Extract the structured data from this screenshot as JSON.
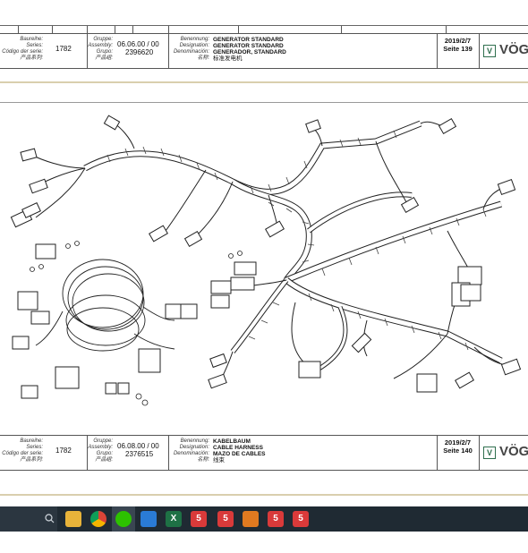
{
  "top_strip": {},
  "header1": {
    "series_label_de": "Baureihe:",
    "series_label_en": "Series:",
    "series_label_es": "Código der serie:",
    "series_label_cn": "产品系列:",
    "series_value": "1782",
    "group_label_de": "Gruppe:",
    "group_label_en": "Assembly:",
    "group_label_es": "Grupo:",
    "group_label_cn": "产品组:",
    "group_value": "06.06.00 / 00",
    "group_number": "2396620",
    "name_label_de": "Benennung:",
    "name_label_en": "Designation:",
    "name_label_es": "Denominación:",
    "name_label_cn": "名称:",
    "name_de": "GENERATOR STANDARD",
    "name_en": "GENERATOR STANDARD",
    "name_es": "GENERADOR, STANDARD",
    "name_cn": "标准发电机",
    "date": "2019/2/7",
    "page": "Seite 139",
    "logo_text": "VÖG"
  },
  "header2": {
    "series_label_de": "Baureihe:",
    "series_label_en": "Series:",
    "series_label_es": "Código der serie:",
    "series_label_cn": "产品系列:",
    "series_value": "1782",
    "group_label_de": "Gruppe:",
    "group_label_en": "Assembly:",
    "group_label_es": "Grupo:",
    "group_label_cn": "产品组:",
    "group_value": "06.08.00 / 00",
    "group_number": "2376515",
    "name_label_de": "Benennung:",
    "name_label_en": "Designation:",
    "name_label_es": "Denominación:",
    "name_label_cn": "名称:",
    "name_de": "KABELBAUM",
    "name_en": "CABLE HARNESS",
    "name_es": "MAZO DE CABLES",
    "name_cn": "线束",
    "date": "2019/2/7",
    "page": "Seite 140",
    "logo_text": "VÖG"
  },
  "drawing": {
    "subject": "cable-harness-exploded-drawing"
  },
  "taskbar": {
    "search_icon": "search-icon",
    "apps": [
      "file-explorer-icon",
      "chrome-icon",
      "wechat-icon",
      "app-icon",
      "excel-icon",
      "app-f5-icon",
      "app-f5-icon",
      "app-orange-icon",
      "app-f5-icon",
      "app-f5-icon"
    ],
    "colors": {
      "bar": "#1f2a33",
      "excel": "#1e7145",
      "chrome": "#f4b400",
      "folder": "#e8b33a",
      "f5": "#d93a3a",
      "wechat": "#2dc100"
    }
  }
}
